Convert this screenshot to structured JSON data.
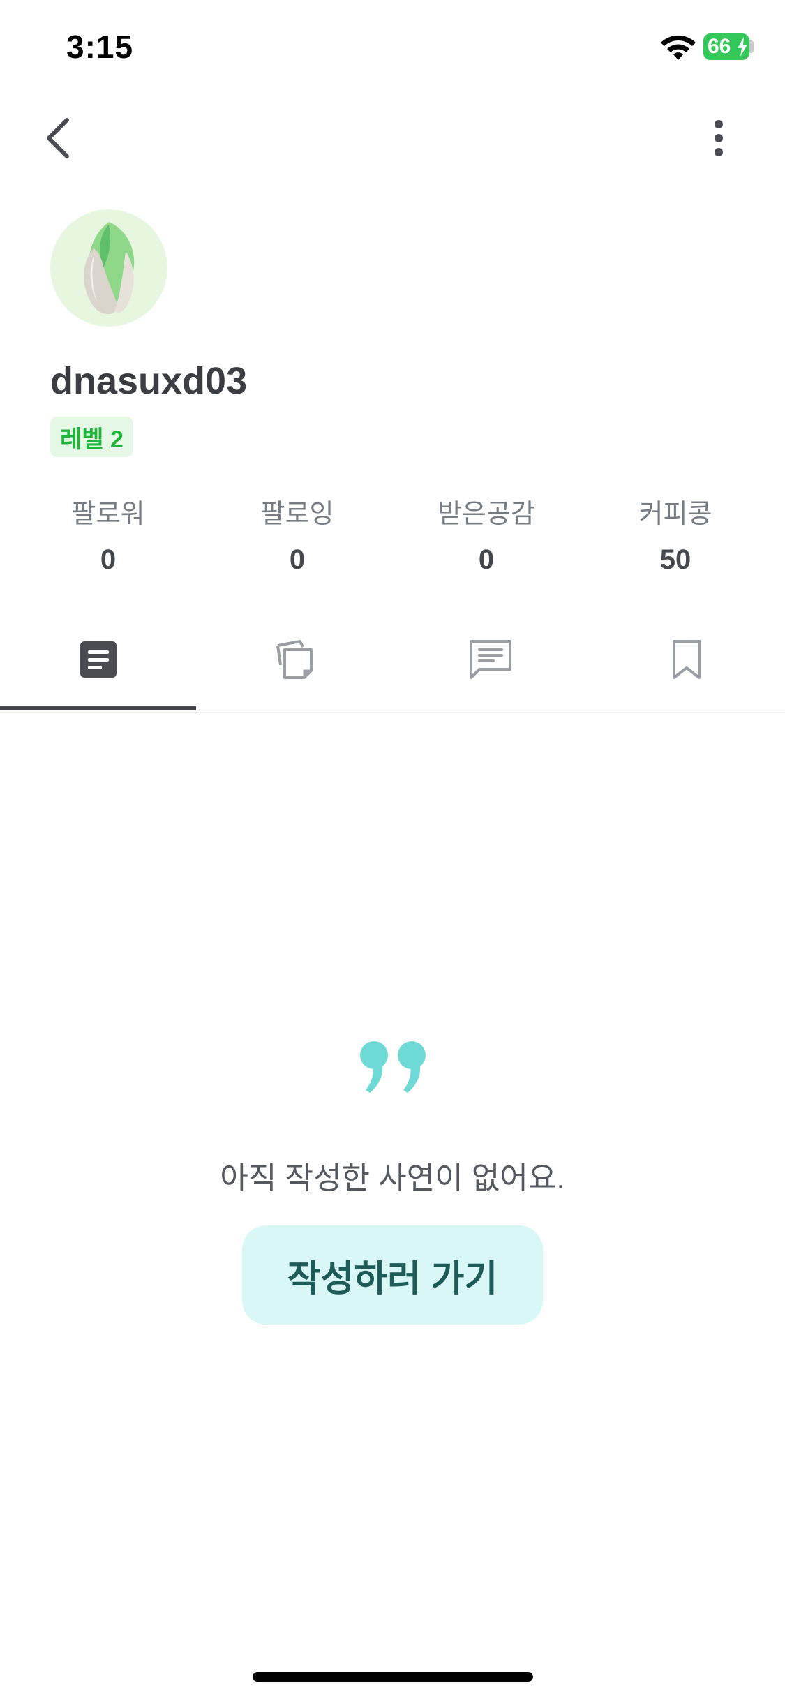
{
  "status_bar": {
    "time": "3:15",
    "battery_percent": "66",
    "icons": [
      "wifi-icon",
      "battery-icon",
      "charging-bolt-icon"
    ]
  },
  "header": {
    "back_icon": "chevron-left-icon",
    "more_icon": "more-vertical-icon"
  },
  "profile": {
    "avatar_icon": "pistachio-avatar-icon",
    "username": "dnasuxd03",
    "level": "레벨 2"
  },
  "stats": [
    {
      "label": "팔로워",
      "value": "0"
    },
    {
      "label": "팔로잉",
      "value": "0"
    },
    {
      "label": "받은공감",
      "value": "0"
    },
    {
      "label": "커피콩",
      "value": "50"
    }
  ],
  "tabs": [
    {
      "icon": "document-icon",
      "active": true
    },
    {
      "icon": "copy-pages-icon",
      "active": false
    },
    {
      "icon": "comment-icon",
      "active": false
    },
    {
      "icon": "bookmark-icon",
      "active": false
    }
  ],
  "empty_state": {
    "icon": "quote-icon",
    "message": "아직 작성한 사연이 없어요.",
    "button_label": "작성하러 가기"
  },
  "colors": {
    "accent_mint": "#6fd9d6",
    "button_bg": "#d8f7f6",
    "button_text": "#1c5b57",
    "level_green": "#1fb43a",
    "level_bg": "#e4f8e5",
    "tab_active": "#45474d",
    "tab_inactive": "#9a9da3"
  }
}
